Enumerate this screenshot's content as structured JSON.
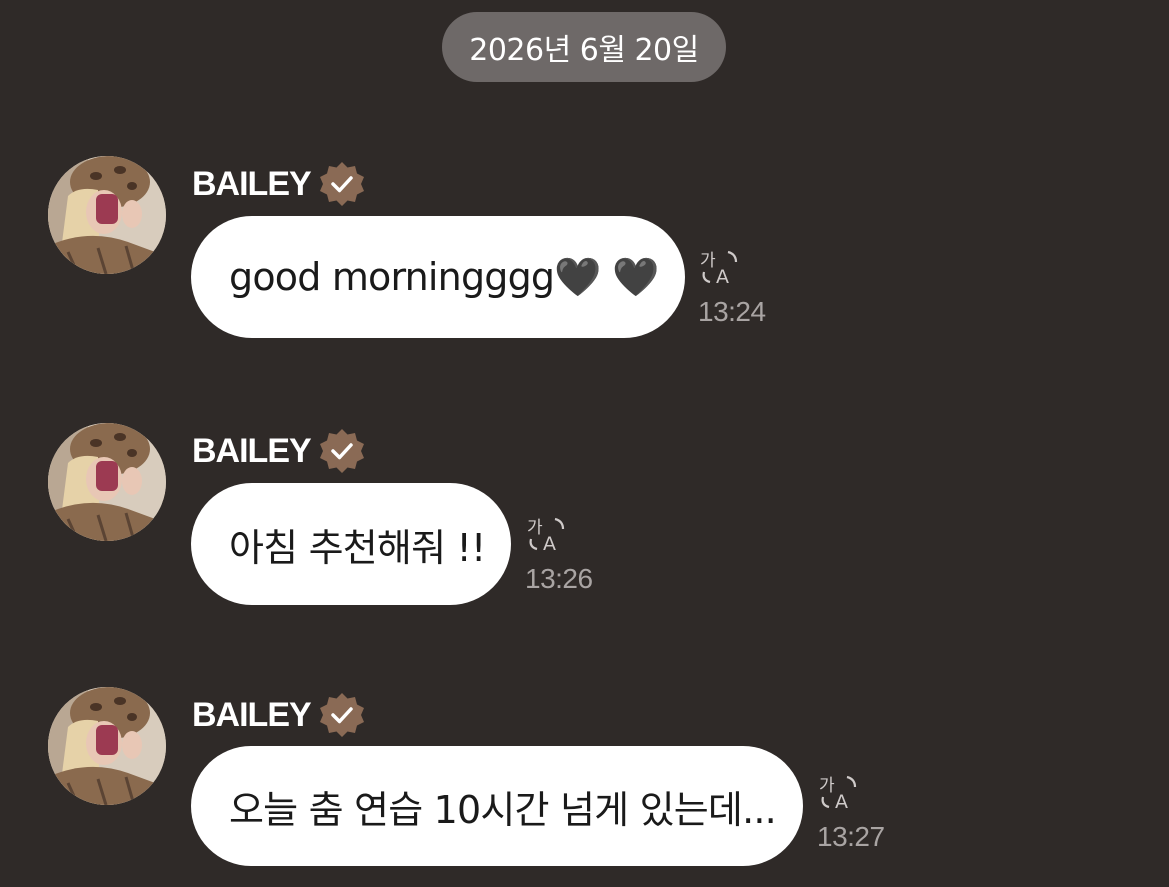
{
  "date_divider": "2026년 6월 20일",
  "colors": {
    "background": "#2f2a28",
    "date_pill": "#6e6968",
    "bubble": "#ffffff",
    "badge": "#8a6a55",
    "timestamp": "#a9a4a3"
  },
  "messages": [
    {
      "sender": "BAILEY",
      "verified": true,
      "text": "good morningggg🖤 🖤",
      "time": "13:24",
      "translate_icon": "translate-icon"
    },
    {
      "sender": "BAILEY",
      "verified": true,
      "text": "아침 추천해줘 !!",
      "time": "13:26",
      "translate_icon": "translate-icon"
    },
    {
      "sender": "BAILEY",
      "verified": true,
      "text": "오늘 춤 연습 10시간 넘게 있는데...",
      "time": "13:27",
      "translate_icon": "translate-icon"
    }
  ]
}
